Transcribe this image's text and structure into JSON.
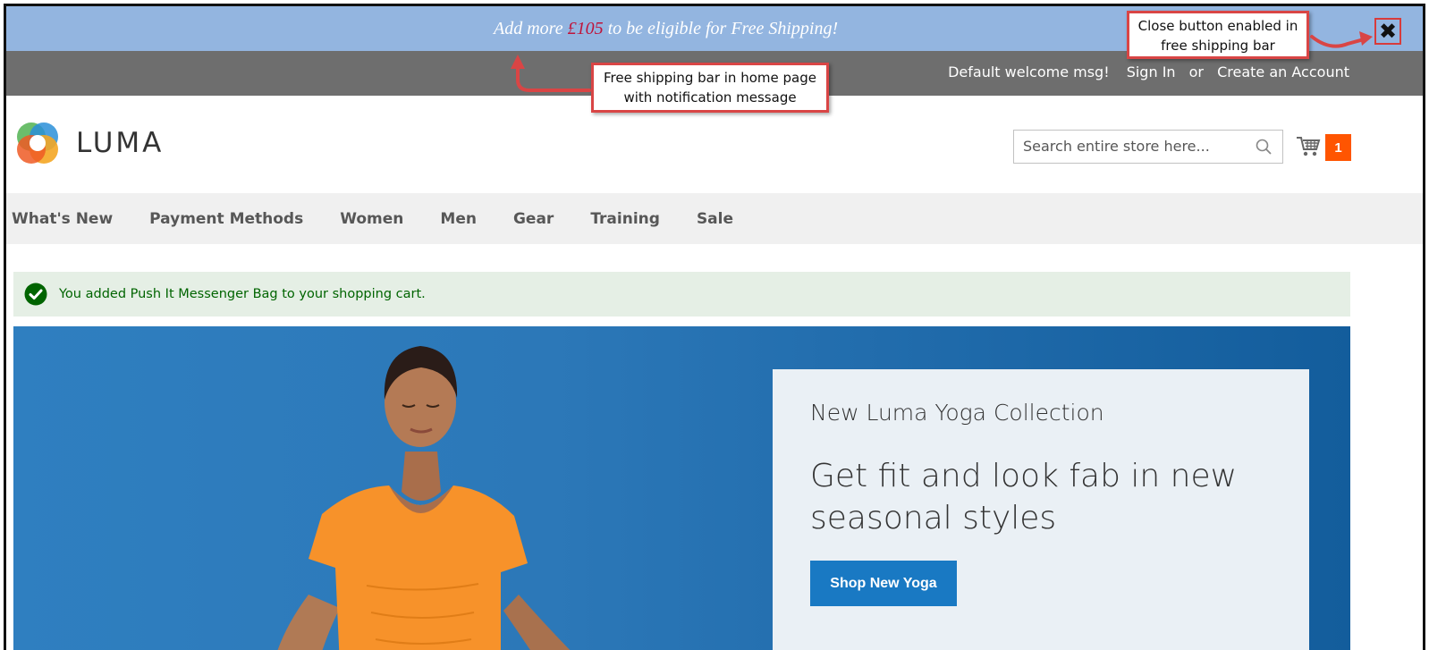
{
  "shipping_bar": {
    "message_prefix": "Add more ",
    "amount": "£105",
    "message_suffix": " to be eligible for Free Shipping!",
    "close_symbol": "✖"
  },
  "header": {
    "welcome": "Default welcome msg!",
    "sign_in": "Sign In",
    "or": "or",
    "create_account": "Create an Account"
  },
  "logo": {
    "text": "LUMA"
  },
  "search": {
    "placeholder": "Search entire store here..."
  },
  "cart": {
    "count": "1"
  },
  "nav": {
    "items": [
      {
        "label": "What's New"
      },
      {
        "label": "Payment Methods"
      },
      {
        "label": "Women"
      },
      {
        "label": "Men"
      },
      {
        "label": "Gear"
      },
      {
        "label": "Training"
      },
      {
        "label": "Sale"
      }
    ]
  },
  "message": {
    "text": "You added Push It Messenger Bag to your shopping cart."
  },
  "hero": {
    "subtitle": "New Luma Yoga Collection",
    "title": "Get fit and look fab in new seasonal styles",
    "button": "Shop New Yoga"
  },
  "annotations": {
    "close_callout": "Close button enabled in free shipping bar",
    "bar_callout": "Free shipping bar in home page with notification message"
  },
  "colors": {
    "shipping_bar": "#93b5e0",
    "header_bar": "#6e6e6e",
    "cart_badge": "#ff5501",
    "button": "#1979c3",
    "success_bg": "#e5efe5",
    "callout_border": "#d94545"
  }
}
